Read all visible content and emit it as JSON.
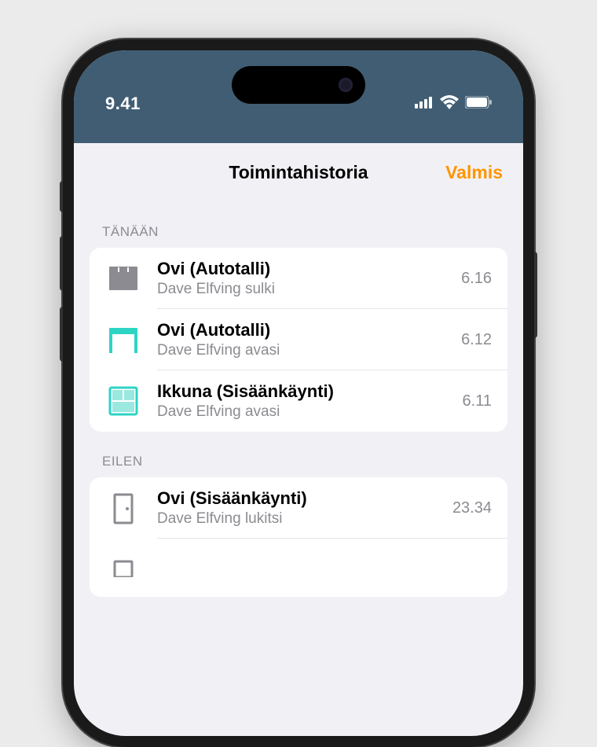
{
  "status": {
    "time": "9.41"
  },
  "header": {
    "title": "Toimintahistoria",
    "done": "Valmis"
  },
  "sections": [
    {
      "label": "TÄNÄÄN",
      "items": [
        {
          "icon": "garage-closed",
          "title": "Ovi (Autotalli)",
          "subtitle": "Dave Elfving sulki",
          "time": "6.16"
        },
        {
          "icon": "garage-open",
          "title": "Ovi (Autotalli)",
          "subtitle": "Dave Elfving avasi",
          "time": "6.12"
        },
        {
          "icon": "window-open",
          "title": "Ikkuna (Sisäänkäynti)",
          "subtitle": "Dave Elfving avasi",
          "time": "6.11"
        }
      ]
    },
    {
      "label": "EILEN",
      "items": [
        {
          "icon": "door-locked",
          "title": "Ovi (Sisäänkäynti)",
          "subtitle": "Dave Elfving lukitsi",
          "time": "23.34"
        }
      ]
    }
  ]
}
